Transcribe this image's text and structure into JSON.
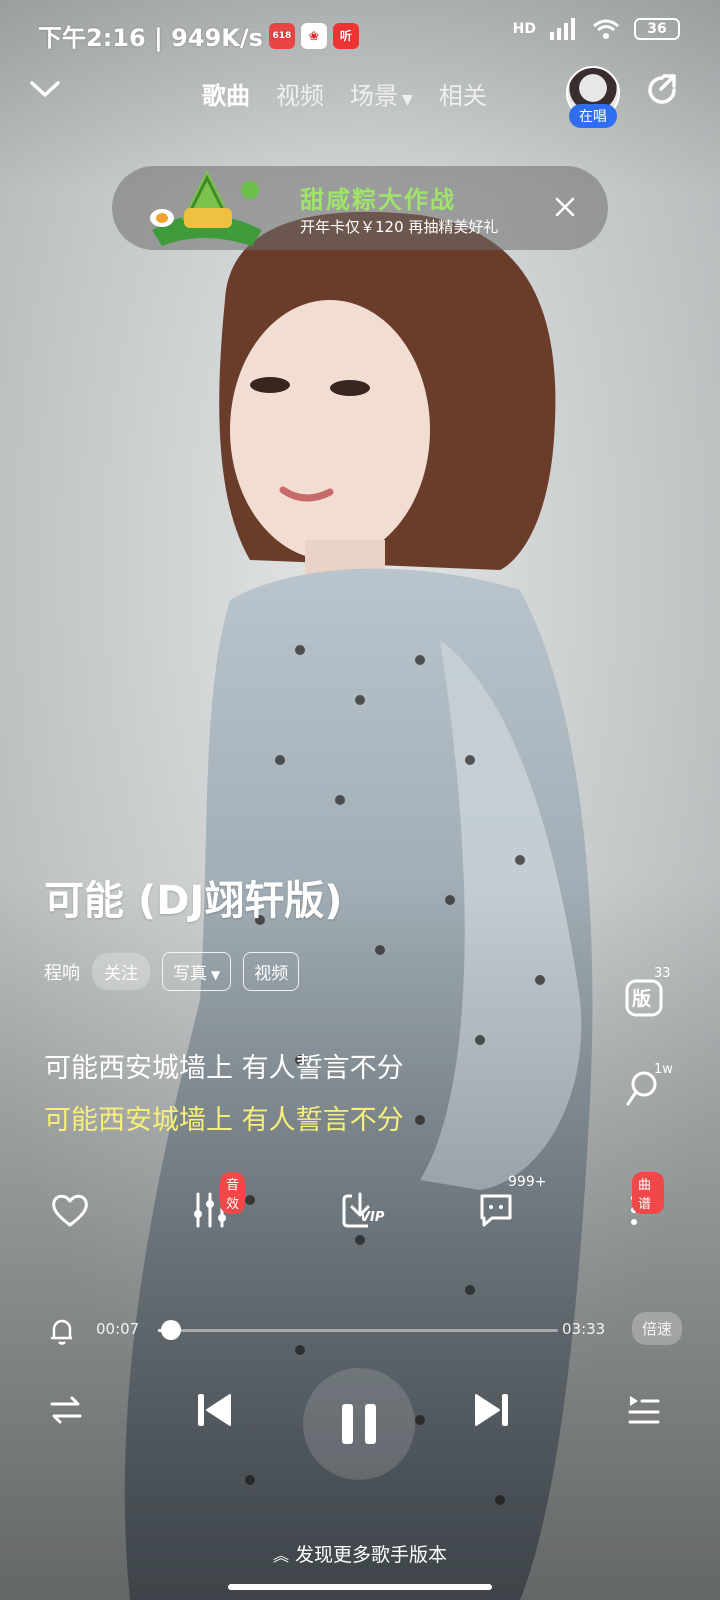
{
  "status": {
    "time_speed": "下午2:16 | 949K/s",
    "app_badge_1": "618",
    "app_badge_3": "听",
    "network": "HD",
    "battery": "36"
  },
  "nav": {
    "tabs": [
      {
        "label": "歌曲",
        "active": true
      },
      {
        "label": "视频",
        "active": false
      },
      {
        "label": "场景",
        "active": false
      },
      {
        "label": "相关",
        "active": false
      }
    ],
    "avatar_badge": "在唱"
  },
  "banner": {
    "title": "甜咸粽大作战",
    "subtitle": "开年卡仅￥120 再抽精美好礼"
  },
  "song": {
    "title": "可能 (DJ翊轩版)",
    "artist": "程响",
    "follow": "关注",
    "photo": "写真",
    "video": "视频"
  },
  "lyrics": {
    "line1": "可能西安城墙上 有人誓言不分",
    "line2": "可能西安城墙上 有人誓言不分"
  },
  "side": {
    "version_count": "33",
    "version_label": "版",
    "ringtone_count": "1w"
  },
  "actions": {
    "sound_effect_badge": "音效",
    "comment_count": "999+",
    "score_badge": "曲谱",
    "vip_label": "VIP"
  },
  "progress": {
    "current": "00:07",
    "total": "03:33",
    "fraction": 0.033,
    "speed_label": "倍速"
  },
  "footer": {
    "more_versions": "发现更多歌手版本"
  }
}
